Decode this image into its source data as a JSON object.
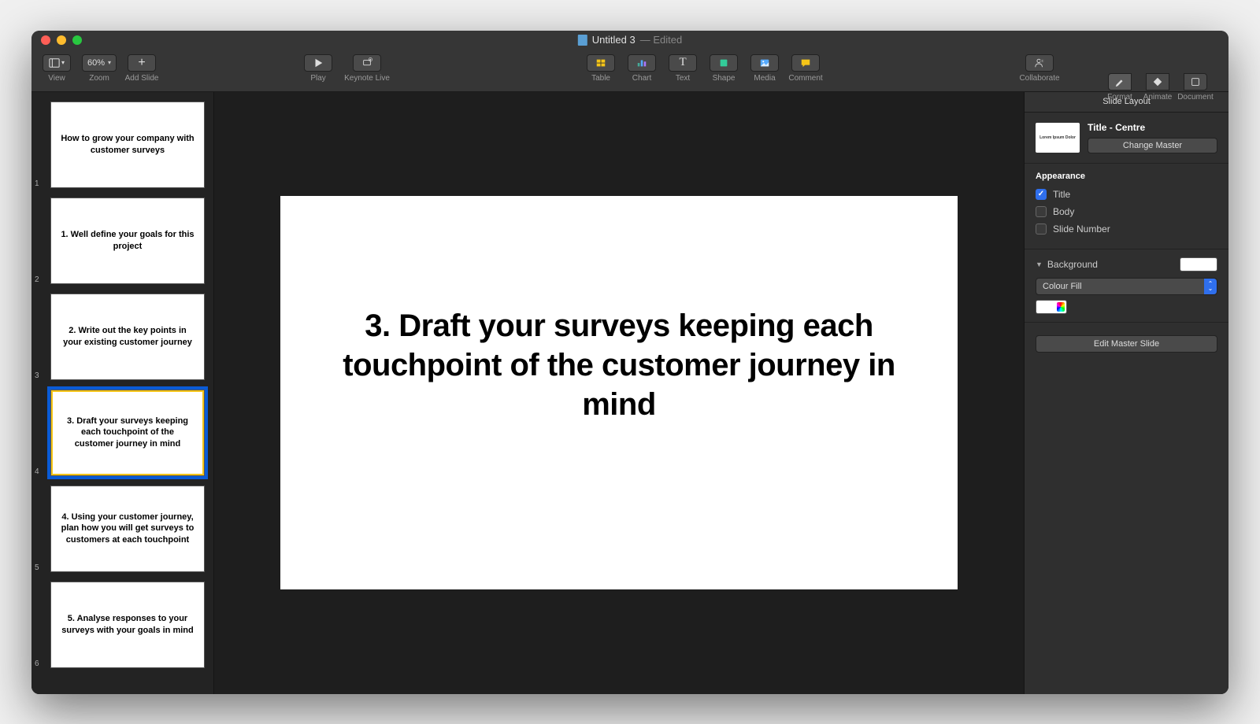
{
  "window": {
    "title": "Untitled 3",
    "status": "— Edited"
  },
  "toolbar": {
    "view": "View",
    "zoom_label": "Zoom",
    "zoom_value": "60%",
    "add_slide": "Add Slide",
    "play": "Play",
    "keynote_live": "Keynote Live",
    "table": "Table",
    "chart": "Chart",
    "text": "Text",
    "shape": "Shape",
    "media": "Media",
    "comment": "Comment",
    "collaborate": "Collaborate",
    "format": "Format",
    "animate": "Animate",
    "document": "Document"
  },
  "slides": [
    {
      "num": "1",
      "title": "How to grow your company with customer surveys"
    },
    {
      "num": "2",
      "title": "1. Well define your goals for this project"
    },
    {
      "num": "3",
      "title": "2. Write out the key points in your existing customer journey"
    },
    {
      "num": "4",
      "title": "3. Draft your surveys keeping each touchpoint of the customer journey in mind",
      "selected": true
    },
    {
      "num": "5",
      "title": "4. Using your customer journey, plan how you will get surveys to customers at each touchpoint"
    },
    {
      "num": "6",
      "title": "5. Analyse responses to your surveys with your goals in mind"
    }
  ],
  "canvas": {
    "title": "3. Draft your surveys keeping each touchpoint of the customer journey in mind"
  },
  "inspector": {
    "header": "Slide Layout",
    "master_name": "Title - Centre",
    "master_thumb_text": "Lorem Ipsum Dolor",
    "change_master": "Change Master",
    "appearance_label": "Appearance",
    "title_check": "Title",
    "body_check": "Body",
    "slidenum_check": "Slide Number",
    "background_label": "Background",
    "fill_type": "Colour Fill",
    "edit_master": "Edit Master Slide"
  }
}
